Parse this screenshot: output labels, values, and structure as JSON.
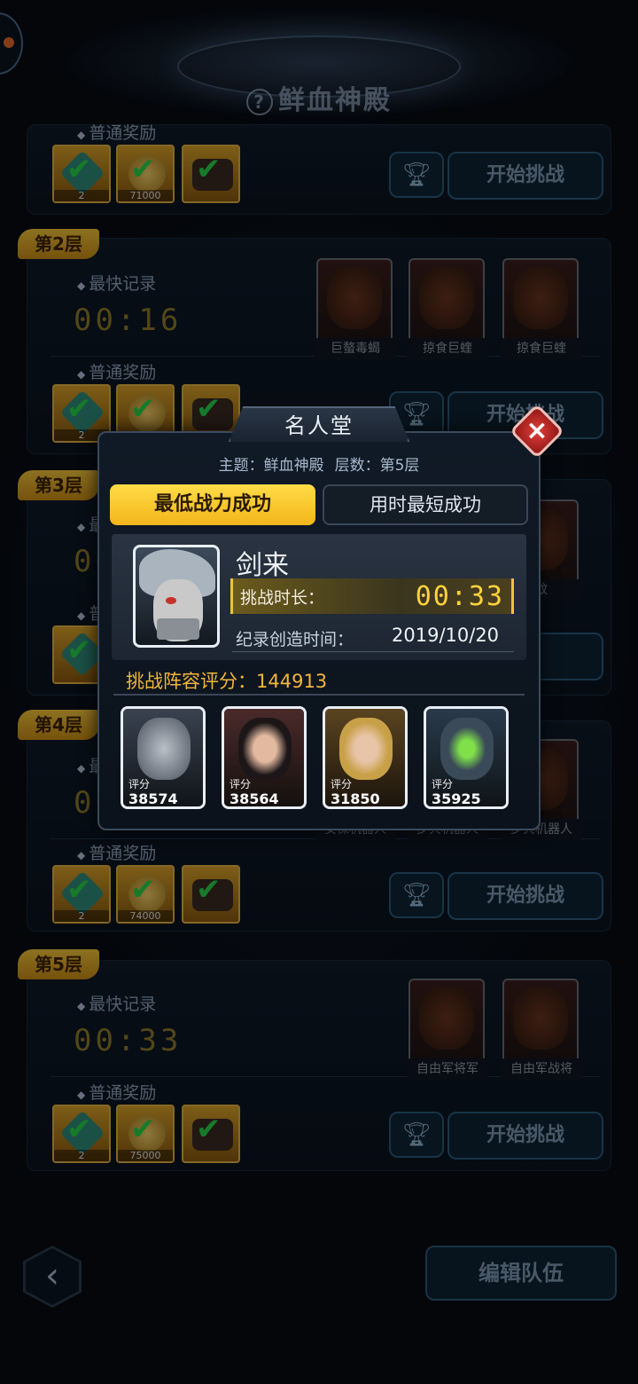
{
  "page": {
    "title": "鲜血神殿",
    "help_icon": "?"
  },
  "floors": [
    {
      "id": "top",
      "reward_label": "普通奖励",
      "rewards": [
        {
          "icon": "gem-icon",
          "qty": "2"
        },
        {
          "icon": "coin-icon",
          "qty": "71000"
        },
        {
          "icon": "item-icon",
          "qty": ""
        }
      ],
      "start_label": "开始挑战"
    },
    {
      "id": "floor2",
      "tag": "第2层",
      "fastest_label": "最快记录",
      "fastest_time": "00:16",
      "reward_label": "普通奖励",
      "rewards": [
        {
          "icon": "gem-icon",
          "qty": "2"
        },
        {
          "icon": "coin-icon",
          "qty": ""
        },
        {
          "icon": "item-icon",
          "qty": ""
        }
      ],
      "enemies": [
        "巨螯毒蝎",
        "掠食巨蝰",
        "掠食巨蝰"
      ],
      "start_label": "开始挑战"
    },
    {
      "id": "floor3",
      "tag": "第3层",
      "fastest_label": "最快",
      "fastest_time": "00",
      "reward_label": "普通",
      "start_label": "战",
      "enemy_partial": "蚊"
    },
    {
      "id": "floor4",
      "tag": "第4层",
      "fastest_label": "最快",
      "fastest_time": "00",
      "reward_label": "普通奖励",
      "rewards": [
        {
          "icon": "gem-icon",
          "qty": "2"
        },
        {
          "icon": "coin-icon",
          "qty": "74000"
        },
        {
          "icon": "item-icon",
          "qty": ""
        }
      ],
      "enemies": [
        "安保机器人",
        "步兵机器人",
        "步兵机器人"
      ],
      "start_label": "开始挑战"
    },
    {
      "id": "floor5",
      "tag": "第5层",
      "fastest_label": "最快记录",
      "fastest_time": "00:33",
      "reward_label": "普通奖励",
      "rewards": [
        {
          "icon": "gem-icon",
          "qty": "2"
        },
        {
          "icon": "coin-icon",
          "qty": "75000"
        },
        {
          "icon": "item-icon",
          "qty": ""
        }
      ],
      "enemies": [
        "自由军将军",
        "自由军战将"
      ],
      "start_label": "开始挑战"
    }
  ],
  "bottom": {
    "back_icon": "‹",
    "edit_team_label": "编辑队伍"
  },
  "modal": {
    "title": "名人堂",
    "close_icon": "×",
    "subtitle_theme": "主题：鲜血神殿",
    "subtitle_floor": "层数：第5层",
    "tabs": [
      "最低战力成功",
      "用时最短成功"
    ],
    "active_tab": 0,
    "player_name": "剑来",
    "duration_label": "挑战时长：",
    "duration_value": "00:33",
    "created_label": "纪录创造时间：",
    "created_value": "2019/10/20",
    "lineup_label": "挑战阵容评分：",
    "lineup_score": "144913",
    "heroes": [
      {
        "score_label": "评分",
        "score": "38574"
      },
      {
        "score_label": "评分",
        "score": "38564"
      },
      {
        "score_label": "评分",
        "score": "31850"
      },
      {
        "score_label": "评分",
        "score": "35925"
      }
    ]
  },
  "colors": {
    "accent_gold": "#f3c43a",
    "check_green": "#28d24a",
    "close_red": "#e0413c"
  }
}
